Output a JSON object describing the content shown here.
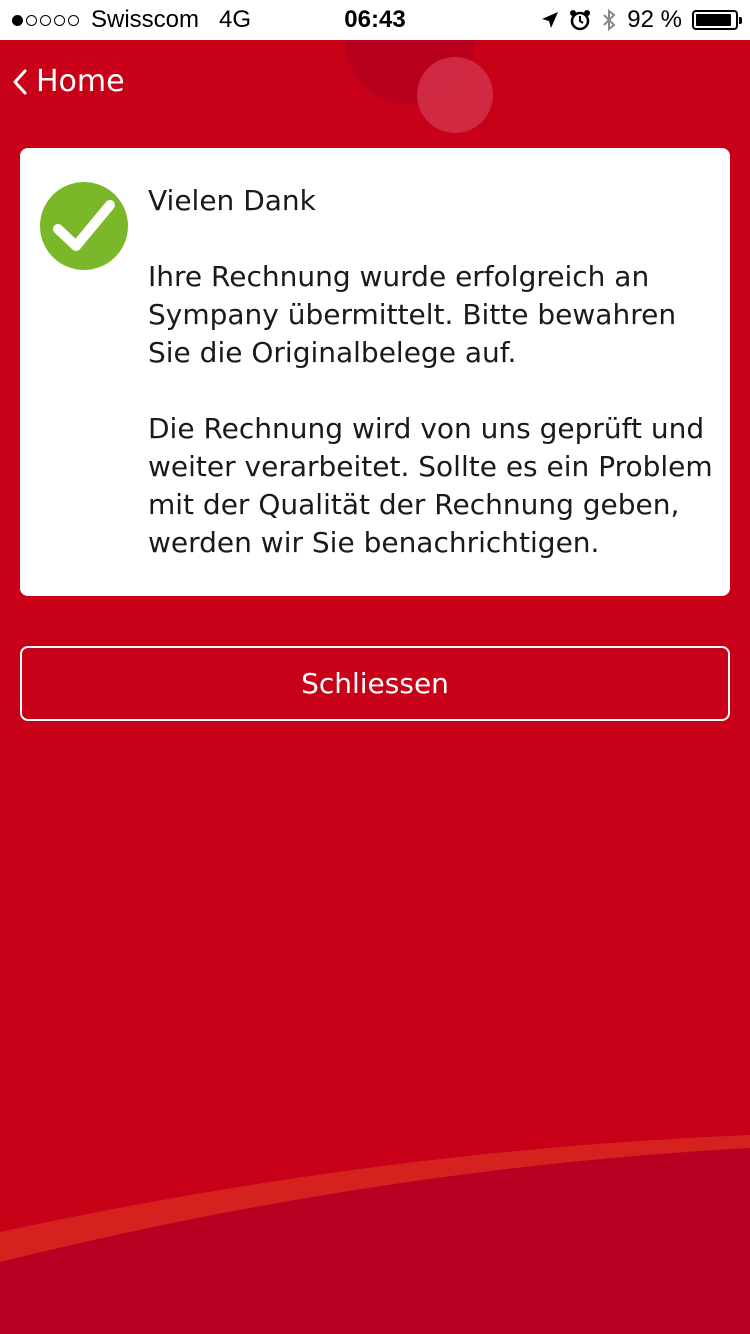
{
  "status_bar": {
    "carrier": "Swisscom",
    "network": "4G",
    "time": "06:43",
    "battery_text": "92 %",
    "battery_level": 0.92,
    "signal_bars_filled": 1,
    "signal_bars_total": 5
  },
  "nav": {
    "back_label": "Home"
  },
  "card": {
    "title": "Vielen Dank",
    "paragraph_1": "Ihre Rechnung wurde erfolgreich an Sympany übermittelt. Bitte bewahren Sie die Originalbelege auf.",
    "paragraph_2": "Die Rechnung wird von uns geprüft und weiter verarbeitet. Sollte es ein Problem mit der Qualität der Rechnung geben, werden wir Sie benachrichtigen.",
    "icon": "checkmark-circle-icon"
  },
  "actions": {
    "close_label": "Schliessen"
  },
  "colors": {
    "background": "#c80018",
    "success": "#7ab829",
    "card": "#ffffff",
    "text_dark": "#1a1a1a"
  }
}
